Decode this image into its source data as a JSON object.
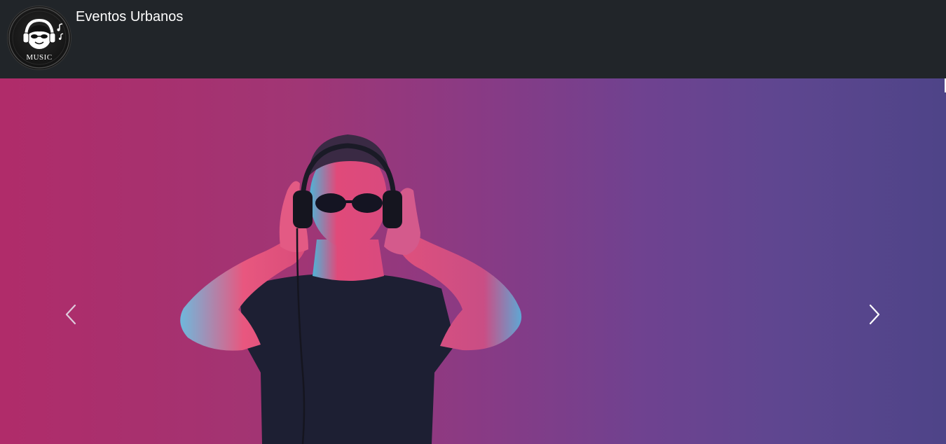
{
  "navbar": {
    "brand_title": "Eventos Urbanos",
    "logo": {
      "text": "MUSIC",
      "icon": "headphones-face-music-logo"
    }
  },
  "carousel": {
    "prev_icon": "chevron-left-icon",
    "next_icon": "chevron-right-icon",
    "slide_image": "man-with-headphones-and-sunglasses-neon-light"
  },
  "colors": {
    "navbar_bg": "#212529",
    "text": "#ffffff",
    "slide_left": "#b02c6a",
    "slide_right": "#4e4488"
  }
}
